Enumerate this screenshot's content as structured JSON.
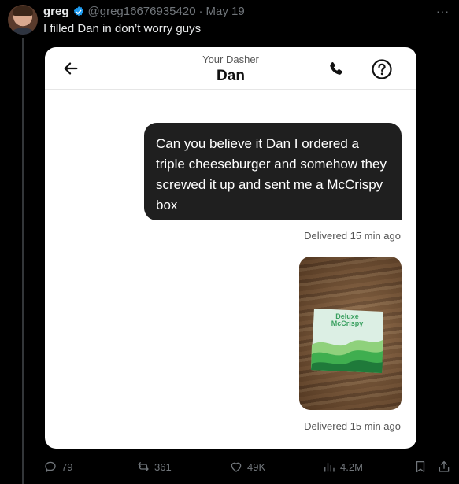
{
  "tweet": {
    "author_name": "greg",
    "handle": "@greg16676935420",
    "separator": "·",
    "date": "May 19",
    "text": "I filled Dan in don’t worry guys",
    "more": "···"
  },
  "chat_card": {
    "subtitle": "Your Dasher",
    "dasher_name": "Dan",
    "message": "Can you believe it Dan I ordered a triple cheeseburger and somehow they screwed it up and sent me a McCrispy box",
    "status_message": "Delivered 15 min ago",
    "photo_box_label_line1": "Deluxe",
    "photo_box_label_line2": "McCrispy",
    "status_photo": "Delivered 15 min ago"
  },
  "actions": {
    "replies": "79",
    "reposts": "361",
    "likes": "49K",
    "views": "4.2M"
  },
  "colors": {
    "background": "#000000",
    "text": "#e7e9ea",
    "muted": "#71767b",
    "verified": "#1d9bf0",
    "bubble": "#1f1f1f"
  },
  "icons": [
    "verified-badge-icon",
    "more-icon",
    "back-arrow-icon",
    "phone-icon",
    "help-icon",
    "reply-icon",
    "repost-icon",
    "like-icon",
    "views-icon",
    "bookmark-icon",
    "share-icon"
  ]
}
